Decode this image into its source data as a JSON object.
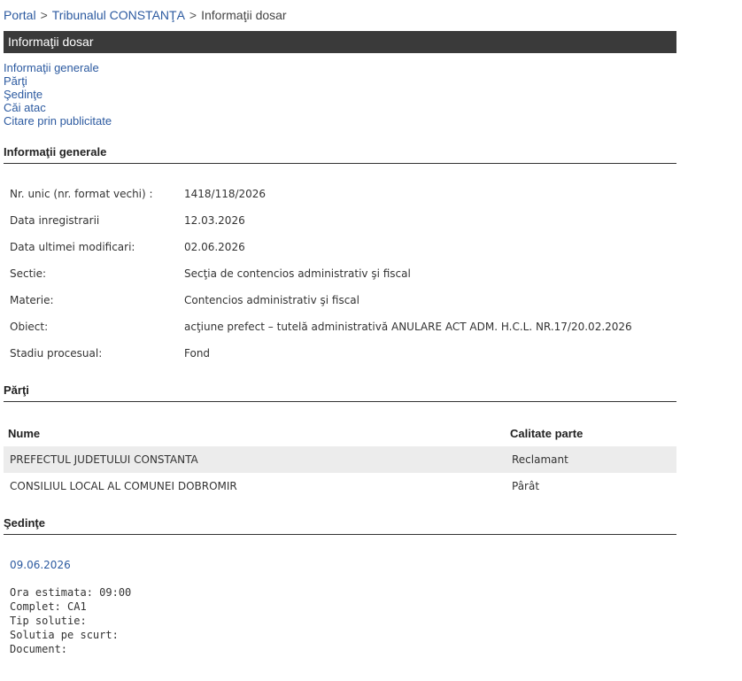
{
  "breadcrumb": {
    "items": [
      {
        "label": "Portal"
      },
      {
        "label": "Tribunalul CONSTANŢA"
      }
    ],
    "separator": ">",
    "current": "Informaţii dosar"
  },
  "page_title": "Informaţii dosar",
  "nav": {
    "items": [
      {
        "label": "Informaţii generale"
      },
      {
        "label": "Părţi"
      },
      {
        "label": "Şedinţe"
      },
      {
        "label": "Căi atac"
      },
      {
        "label": "Citare prin publicitate"
      }
    ]
  },
  "general": {
    "heading": "Informaţii generale",
    "rows": [
      {
        "label": "Nr. unic (nr. format vechi) :",
        "value": "1418/118/2026"
      },
      {
        "label": "Data inregistrarii",
        "value": "12.03.2026"
      },
      {
        "label": "Data ultimei modificari:",
        "value": "02.06.2026"
      },
      {
        "label": "Sectie:",
        "value": "Secţia de contencios administrativ şi fiscal"
      },
      {
        "label": "Materie:",
        "value": "Contencios administrativ şi fiscal"
      },
      {
        "label": "Obiect:",
        "value": "acţiune prefect – tutelă administrativă ANULARE ACT ADM. H.C.L. NR.17/20.02.2026"
      },
      {
        "label": "Stadiu procesual:",
        "value": "Fond"
      }
    ]
  },
  "parti": {
    "heading": "Părţi",
    "columns": [
      "Nume",
      "Calitate parte"
    ],
    "rows": [
      {
        "name": "PREFECTUL JUDETULUI CONSTANTA",
        "role": "Reclamant"
      },
      {
        "name": "CONSILIUL LOCAL AL COMUNEI DOBROMIR",
        "role": "Pârât"
      }
    ]
  },
  "sedinte": {
    "heading": "Şedinţe",
    "date": "09.06.2026",
    "details": [
      "Ora estimata: 09:00",
      "Complet: CA1",
      "Tip solutie:",
      "Solutia pe scurt:",
      "Document:"
    ]
  },
  "colors": {
    "link": "#2c5aa0",
    "title_bar": "#3a3a3a",
    "alt_row": "#ececec"
  }
}
